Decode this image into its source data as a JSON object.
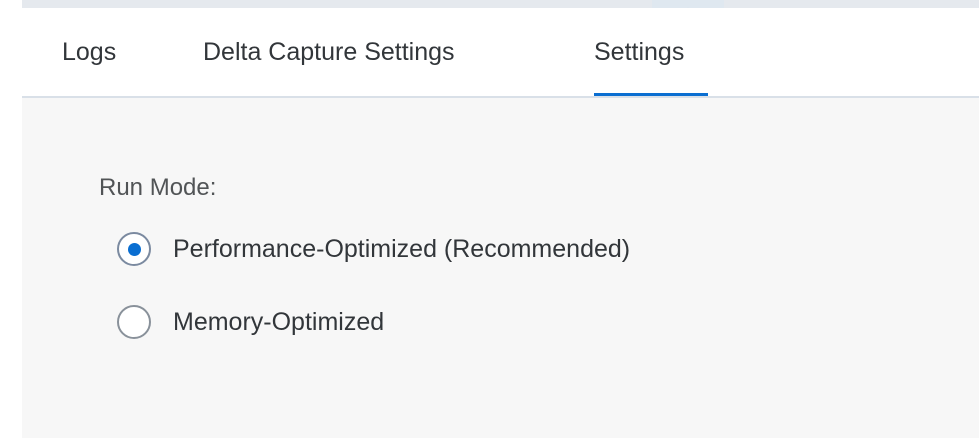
{
  "tabs": [
    {
      "label": "Logs",
      "selected": false
    },
    {
      "label": "Delta Capture Settings",
      "selected": false
    },
    {
      "label": "Settings",
      "selected": true
    }
  ],
  "collapse_handle": {
    "icon": "chevron-up-icon"
  },
  "settings": {
    "run_mode_label": "Run Mode:",
    "options": [
      {
        "label": "Performance-Optimized (Recommended)",
        "selected": true
      },
      {
        "label": "Memory-Optimized",
        "selected": false
      }
    ]
  },
  "colors": {
    "accent": "#0a6ed1",
    "content_background": "#f7f7f7",
    "text": "#32363a"
  }
}
